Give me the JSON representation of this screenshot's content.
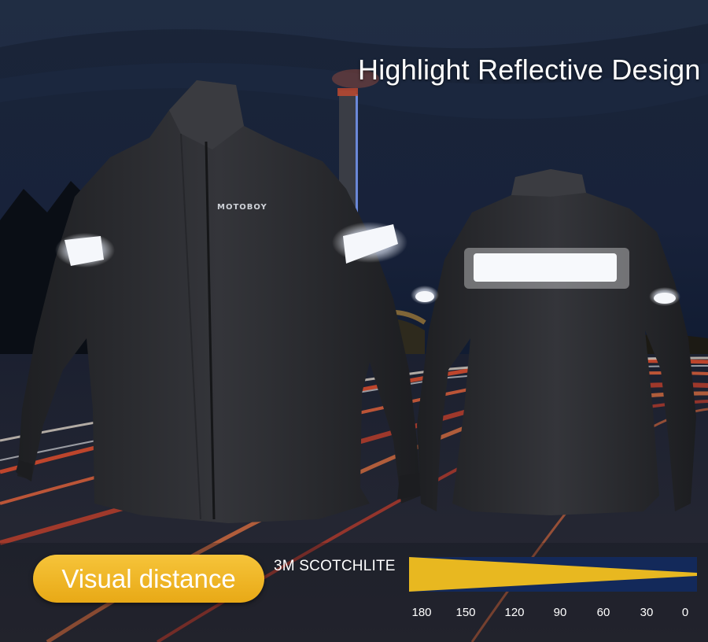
{
  "banner": {
    "headline": "Highlight Reflective Design",
    "brand_logo_text": "MOTOBOY"
  },
  "visual_distance": {
    "label": "Visual distance",
    "material_label": "3M SCOTCHLITE",
    "scale_values": [
      "180",
      "150",
      "120",
      "90",
      "60",
      "30",
      "0"
    ]
  },
  "colors": {
    "accent_gold": "#f2bb2c",
    "wedge_gold": "#e8b820",
    "wedge_navy": "#13295a",
    "jacket": "#2a2b2e",
    "reflective": "#f4f6f8"
  }
}
